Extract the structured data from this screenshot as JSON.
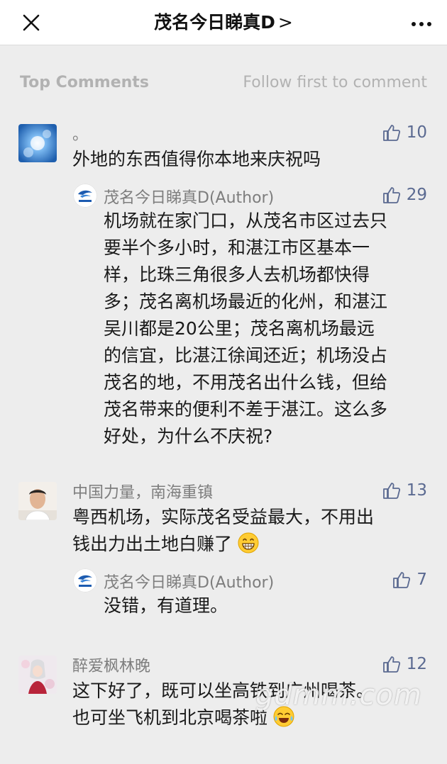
{
  "nav": {
    "title": "茂名今日睇真D",
    "chevron": ">",
    "close_icon": "close-icon",
    "more_icon": "more-icon"
  },
  "header": {
    "top_comments": "Top Comments",
    "follow_link": "Follow first to comment"
  },
  "comments": [
    {
      "nickname": "。",
      "likes": "10",
      "lines": [
        "外地的东西值得你本地来庆祝吗"
      ],
      "reply": {
        "nickname": "茂名今日睇真D(Author)",
        "likes": "29",
        "lines": [
          "机场就在家门口，从茂名市区过去只",
          "要半个多小时，和湛江市区基本一",
          "样，比珠三角很多人去机场都快得",
          "多；茂名离机场最近的化州，和湛江",
          "吴川都是20公里；茂名离机场最远",
          "的信宜，比湛江徐闻还近；机场没占",
          "茂名的地，不用茂名出什么钱，但给",
          "茂名带来的便利不差于湛江。这么多",
          "好处，为什么不庆祝?"
        ]
      }
    },
    {
      "nickname": "中国力量，南海重镇",
      "likes": "13",
      "lines": [
        "粤西机场，实际茂名受益最大，不用出",
        "钱出力出土地白赚了"
      ],
      "emoji": "grin-emoji",
      "reply": {
        "nickname": "茂名今日睇真D(Author)",
        "likes": "7",
        "lines": [
          "没错，有道理。"
        ]
      }
    },
    {
      "nickname": "醉爱枫林晚",
      "likes": "12",
      "lines": [
        "这下好了，既可以坐高铁到广州喝茶。",
        "也可坐飞机到北京喝茶啦"
      ],
      "emoji": "laugh-tears-emoji"
    }
  ],
  "watermark": "gdmm.com",
  "colors": {
    "background": "#ededed",
    "like_blue": "#5b6a91",
    "nickname_gray": "#7d7d7d",
    "header_gray": "#b2b2b2"
  }
}
